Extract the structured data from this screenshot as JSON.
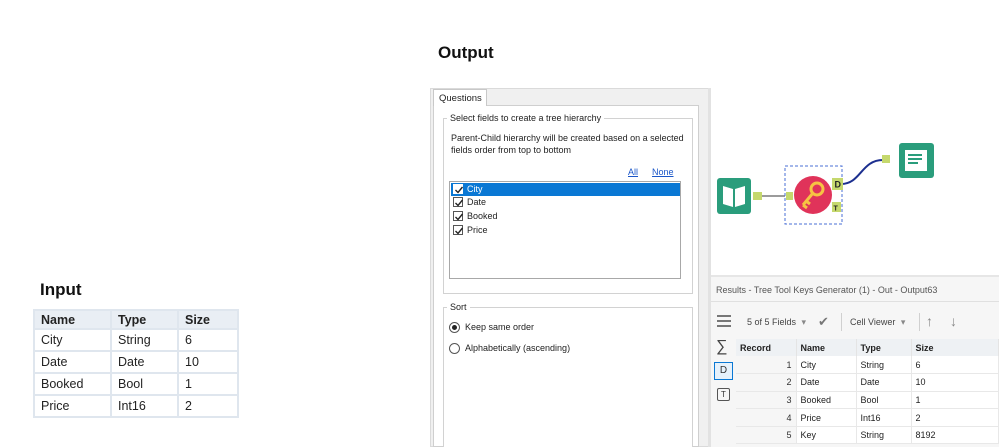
{
  "headings": {
    "output": "Output",
    "input": "Input"
  },
  "input_table": {
    "columns": [
      "Name",
      "Type",
      "Size"
    ],
    "rows": [
      [
        "City",
        "String",
        "6"
      ],
      [
        "Date",
        "Date",
        "10"
      ],
      [
        "Booked",
        "Bool",
        "1"
      ],
      [
        "Price",
        "Int16",
        "2"
      ]
    ]
  },
  "config": {
    "tab": "Questions",
    "group1_legend": "Select fields to create a tree hierarchy",
    "description": "Parent-Child hierarchy will be created based on a selected fields order from top to bottom",
    "link_all": "All",
    "link_none": "None",
    "fields": [
      {
        "label": "City",
        "checked": true,
        "selected": true
      },
      {
        "label": "Date",
        "checked": true,
        "selected": false
      },
      {
        "label": "Booked",
        "checked": true,
        "selected": false
      },
      {
        "label": "Price",
        "checked": true,
        "selected": false
      }
    ],
    "sort_legend": "Sort",
    "sort_options": [
      {
        "label": "Keep same order",
        "selected": true
      },
      {
        "label": "Alphabetically (ascending)",
        "selected": false
      }
    ]
  },
  "workflow": {
    "anchor_d": "D",
    "anchor_t": "T",
    "accent_colors": {
      "input": "#2a9d7c",
      "key": "#e0335a",
      "browse": "#2a9d7c",
      "connector": "#1c2f8f"
    }
  },
  "results": {
    "title": "Results - Tree Tool Keys Generator (1) - Out - Output63",
    "field_count": "5 of 5 Fields",
    "viewer": "Cell Viewer",
    "side_d": "D",
    "side_t": "T",
    "columns": [
      "Record",
      "Name",
      "Type",
      "Size"
    ],
    "rows": [
      [
        "1",
        "City",
        "String",
        "6"
      ],
      [
        "2",
        "Date",
        "Date",
        "10"
      ],
      [
        "3",
        "Booked",
        "Bool",
        "1"
      ],
      [
        "4",
        "Price",
        "Int16",
        "2"
      ],
      [
        "5",
        "Key",
        "String",
        "8192"
      ]
    ]
  }
}
